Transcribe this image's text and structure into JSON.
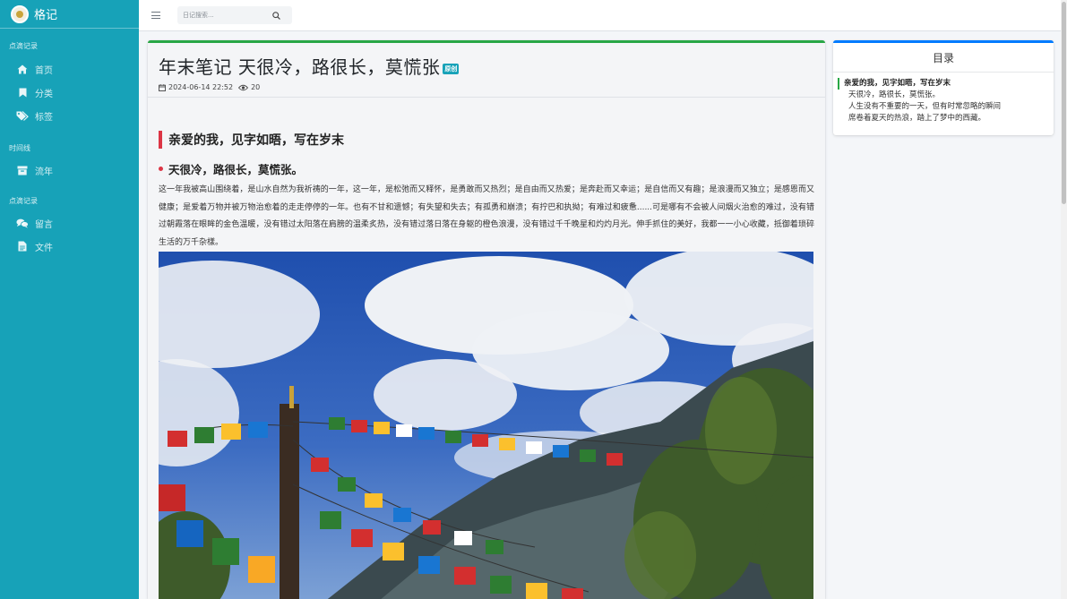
{
  "brand": {
    "name": "格记"
  },
  "sidebar": {
    "sections": [
      {
        "header": "点滴记录",
        "items": [
          {
            "label": "首页",
            "icon": "home-icon"
          },
          {
            "label": "分类",
            "icon": "bookmark-icon"
          },
          {
            "label": "标签",
            "icon": "tags-icon"
          }
        ]
      },
      {
        "header": "时间线",
        "items": [
          {
            "label": "流年",
            "icon": "archive-icon"
          }
        ]
      },
      {
        "header": "点滴记录",
        "items": [
          {
            "label": "留言",
            "icon": "comments-icon"
          },
          {
            "label": "文件",
            "icon": "file-icon"
          }
        ]
      }
    ]
  },
  "topbar": {
    "search_placeholder": "日记搜索..."
  },
  "post": {
    "title": "年末笔记 天很冷，路很长，莫慌张",
    "badge": "原创",
    "date": "2024-06-14 22:52",
    "views": "20",
    "heading1": "亲爱的我，见字如晤，写在岁末",
    "heading2": "天很冷，路很长，莫慌张。",
    "paragraph": "这一年我被高山围绕着，是山水自然为我祈祷的一年，这一年，是松弛而又释怀，是勇敢而又热烈；是自由而又热爱；是奔赴而又幸运；是自信而又有趣；是浪漫而又独立；是感恩而又健康；是爱着万物并被万物治愈着的走走停停的一年。也有不甘和遗憾；有失望和失去；有孤勇和崩溃；有拧巴和执拗；有难过和疲惫......可是哪有不会被人间烟火治愈的难过，没有错过朝霞落在眼眸的金色温暖，没有错过太阳落在肩膀的温柔炙热，没有错过落日落在身躯的橙色浪漫，没有错过千千晚星和灼灼月光。伸手抓住的美好，我都一一小心收藏，抵御着琐碎生活的万千杂樣。"
  },
  "toc": {
    "title": "目录",
    "items": [
      {
        "label": "亲爱的我，见字如晤，写在岁末",
        "active": true
      },
      {
        "label": "天很冷，路很长，莫慌张。",
        "active": false
      },
      {
        "label": "人生没有不重要的一天，但有时常忽略的瞬间",
        "active": false
      },
      {
        "label": "席卷着夏天的热浪，踏上了梦中的西藏。",
        "active": false
      }
    ]
  },
  "colors": {
    "sidebar": "#17a2b8",
    "card_accent": "#28a745",
    "toc_accent": "#007bff",
    "heading_accent": "#dc3545",
    "badge": "#17a2b8"
  }
}
